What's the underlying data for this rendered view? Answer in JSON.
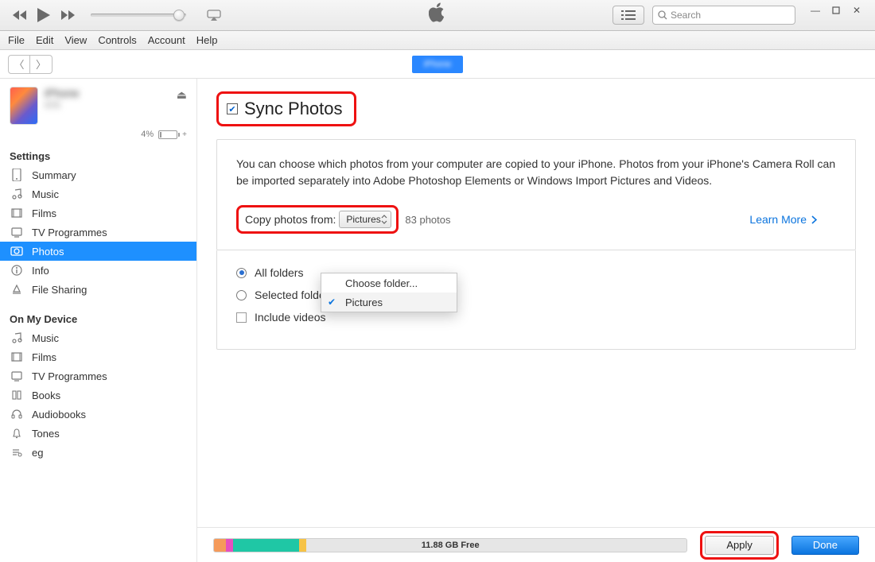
{
  "toolbar": {
    "search_placeholder": "Search"
  },
  "menubar": [
    "File",
    "Edit",
    "View",
    "Controls",
    "Account",
    "Help"
  ],
  "secbar": {
    "center_label": "iPhone"
  },
  "device": {
    "name": "iPhone",
    "subtitle": "iOS",
    "battery_pct": "4%"
  },
  "sidebar": {
    "settings_header": "Settings",
    "settings": [
      {
        "icon": "summary",
        "label": "Summary"
      },
      {
        "icon": "music",
        "label": "Music"
      },
      {
        "icon": "films",
        "label": "Films"
      },
      {
        "icon": "tv",
        "label": "TV Programmes"
      },
      {
        "icon": "photos",
        "label": "Photos",
        "selected": true
      },
      {
        "icon": "info",
        "label": "Info"
      },
      {
        "icon": "sharing",
        "label": "File Sharing"
      }
    ],
    "device_header": "On My Device",
    "device_items": [
      {
        "icon": "music",
        "label": "Music"
      },
      {
        "icon": "films",
        "label": "Films"
      },
      {
        "icon": "tv",
        "label": "TV Programmes"
      },
      {
        "icon": "books",
        "label": "Books"
      },
      {
        "icon": "audiobooks",
        "label": "Audiobooks"
      },
      {
        "icon": "tones",
        "label": "Tones"
      },
      {
        "icon": "eg",
        "label": "eg"
      }
    ]
  },
  "content": {
    "sync_title": "Sync Photos",
    "description": "You can choose which photos from your computer are copied to your iPhone. Photos from your iPhone's Camera Roll can be imported separately into Adobe Photoshop Elements or Windows Import Pictures and Videos.",
    "copy_label": "Copy photos from:",
    "dropdown_value": "Pictures",
    "photo_count": "83 photos",
    "learn_more": "Learn More",
    "flyout": {
      "choose": "Choose folder...",
      "pictures": "Pictures"
    },
    "opt_all": "All folders",
    "opt_selected": "Selected folders",
    "opt_videos": "Include videos"
  },
  "footer": {
    "free_label": "11.88 GB Free",
    "apply": "Apply",
    "done": "Done"
  }
}
